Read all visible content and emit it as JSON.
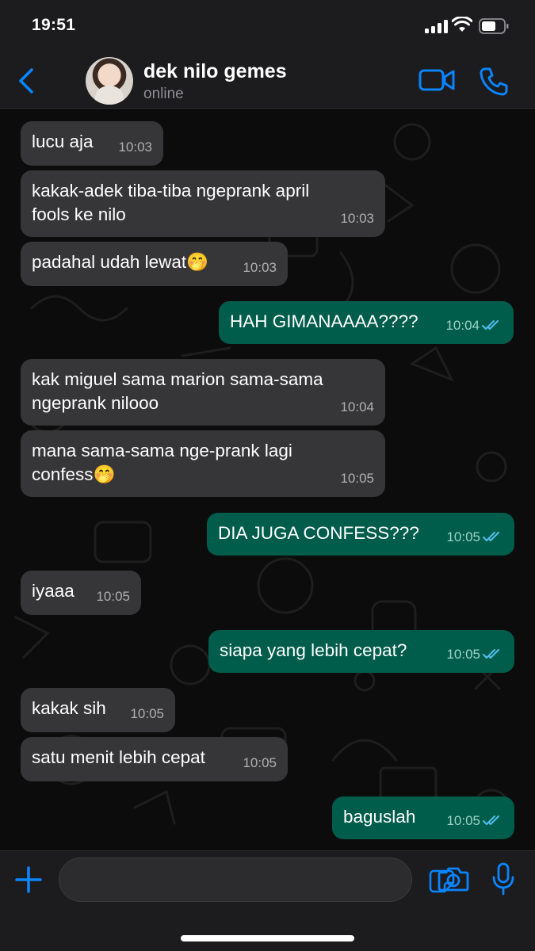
{
  "status_bar": {
    "time": "19:51"
  },
  "header": {
    "contact_name": "dek nilo gemes",
    "contact_status": "online"
  },
  "messages": [
    {
      "direction": "in",
      "text": "lucu aja",
      "time": "10:03"
    },
    {
      "direction": "in",
      "text": "kakak-adek tiba-tiba ngeprank april fools ke nilo",
      "time": "10:03"
    },
    {
      "direction": "in",
      "text": "padahal udah lewat🤭",
      "time": "10:03"
    },
    {
      "direction": "out",
      "text": "HAH GIMANAAAA????",
      "time": "10:04",
      "read": true
    },
    {
      "direction": "in",
      "text": "kak miguel sama marion sama-sama ngeprank nilooo",
      "time": "10:04"
    },
    {
      "direction": "in",
      "text": "mana sama-sama nge-prank lagi confess🤭",
      "time": "10:05"
    },
    {
      "direction": "out",
      "text": "DIA JUGA CONFESS???",
      "time": "10:05",
      "read": true
    },
    {
      "direction": "in",
      "text": "iyaaa",
      "time": "10:05"
    },
    {
      "direction": "out",
      "text": "siapa yang lebih cepat?",
      "time": "10:05",
      "read": true
    },
    {
      "direction": "in",
      "text": "kakak sih",
      "time": "10:05"
    },
    {
      "direction": "in",
      "text": "satu menit lebih cepat",
      "time": "10:05"
    },
    {
      "direction": "out",
      "text": "baguslah",
      "time": "10:05",
      "read": true
    }
  ],
  "colors": {
    "accent": "#0a84ff",
    "incoming_bubble": "#363638",
    "outgoing_bubble": "#005c4b",
    "read_ticks": "#53bdeb"
  },
  "icons": [
    "back-chevron-icon",
    "video-call-icon",
    "phone-icon",
    "plus-icon",
    "sticker-icon",
    "camera-icon",
    "microphone-icon"
  ]
}
